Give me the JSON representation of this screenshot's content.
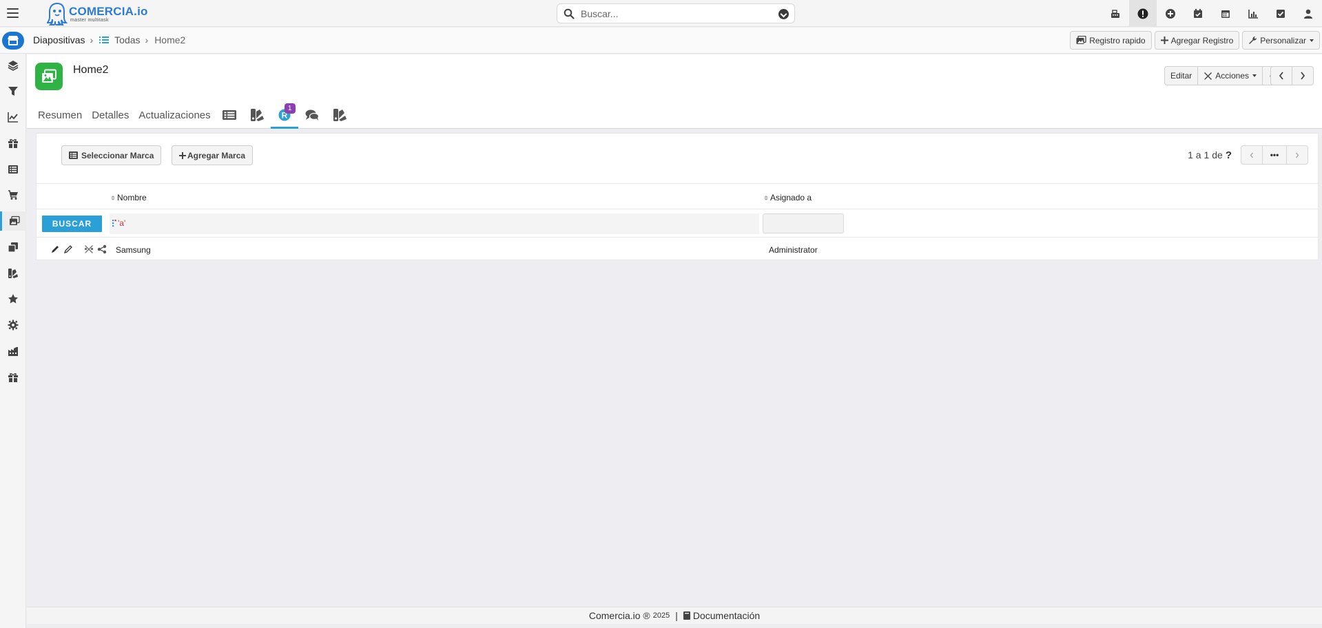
{
  "app": {
    "brand_name": "COMERCIA.io",
    "brand_tagline": "master multitask",
    "brand_color": "#2c7bd6",
    "accent_color": "#2ba0d8"
  },
  "search": {
    "placeholder": "Buscar..."
  },
  "top_icons": [
    "cash-register-icon",
    "alert-icon",
    "plus-circle-icon",
    "calendar-check-icon",
    "calendar-icon",
    "bar-chart-icon",
    "checkbox-icon",
    "user-icon"
  ],
  "breadcrumb": {
    "module": "Diapositivas",
    "list": "Todas",
    "record": "Home2"
  },
  "header_actions": {
    "quick": "Registro rapido",
    "add": "Agregar Registro",
    "customize": "Personalizar"
  },
  "sidebar_icons": [
    "layers-icon",
    "filter-icon",
    "line-chart-icon",
    "gift-icon",
    "list-icon",
    "cart-icon",
    "images-icon",
    "copy-icon",
    "swatches-icon",
    "star-icon",
    "gear-icon",
    "factory-icon",
    "gift-icon"
  ],
  "record": {
    "title": "Home2",
    "edit": "Editar",
    "actions": "Acciones"
  },
  "tabs": {
    "summary": "Resumen",
    "details": "Detalles",
    "updates": "Actualizaciones",
    "badge": "1"
  },
  "subpanel": {
    "select_btn": "Seleccionar Marca",
    "add_btn": "Agregar Marca",
    "pager_text": "1 a 1",
    "pager_of": "de",
    "pager_help": "?",
    "pager_more": "•••",
    "columns": {
      "name": "Nombre",
      "assigned": "Asignado a"
    },
    "search_btn": "BUSCAR",
    "filter_name_value": "a",
    "rows": [
      {
        "name": "Samsung",
        "assigned": "Administrator"
      }
    ]
  },
  "footer": {
    "brand": "Comercia.io ®",
    "year": "2025",
    "separator": "|",
    "docs": "Documentación"
  }
}
